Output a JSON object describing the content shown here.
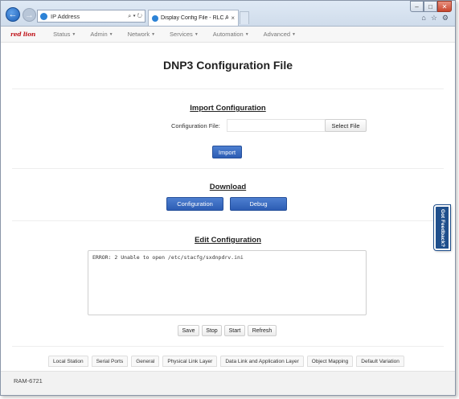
{
  "browser": {
    "address_text": "IP Address",
    "address_controls": "⌕ ▾ ↻",
    "tab_title": "Display Config File - RLC A...",
    "tab_close": "×",
    "window_controls": {
      "minimize": "–",
      "maximize": "□",
      "close": "✕"
    },
    "toolbar_icons": [
      "home-icon",
      "star-icon",
      "gear-icon"
    ]
  },
  "navbar": {
    "logo": "red lion",
    "menu": [
      {
        "label": "Status"
      },
      {
        "label": "Admin"
      },
      {
        "label": "Network"
      },
      {
        "label": "Services"
      },
      {
        "label": "Automation"
      },
      {
        "label": "Advanced"
      }
    ]
  },
  "page": {
    "title": "DNP3 Configuration File",
    "import": {
      "heading": "Import Configuration",
      "file_label": "Configuration File:",
      "file_value": "",
      "select_file_label": "Select File",
      "import_button": "Import"
    },
    "download": {
      "heading": "Download",
      "configuration_button": "Configuration",
      "debug_button": "Debug"
    },
    "edit": {
      "heading": "Edit Configuration",
      "content": "ERROR: 2 Unable to open /etc/stacfg/sxdnpdrv.ini",
      "buttons": {
        "save": "Save",
        "stop": "Stop",
        "start": "Start",
        "refresh": "Refresh"
      }
    },
    "bottom_tabs": [
      "Local Station",
      "Serial Ports",
      "General",
      "Physical Link Layer",
      "Data Link and Application Layer",
      "Object Mapping",
      "Default Variation"
    ]
  },
  "footer": {
    "device": "RAM-6721"
  },
  "feedback": {
    "label": "Got Feedback?"
  },
  "colors": {
    "brand_red": "#c0181e",
    "primary_blue": "#2d5db4",
    "feedback_blue": "#1f4f8c"
  }
}
